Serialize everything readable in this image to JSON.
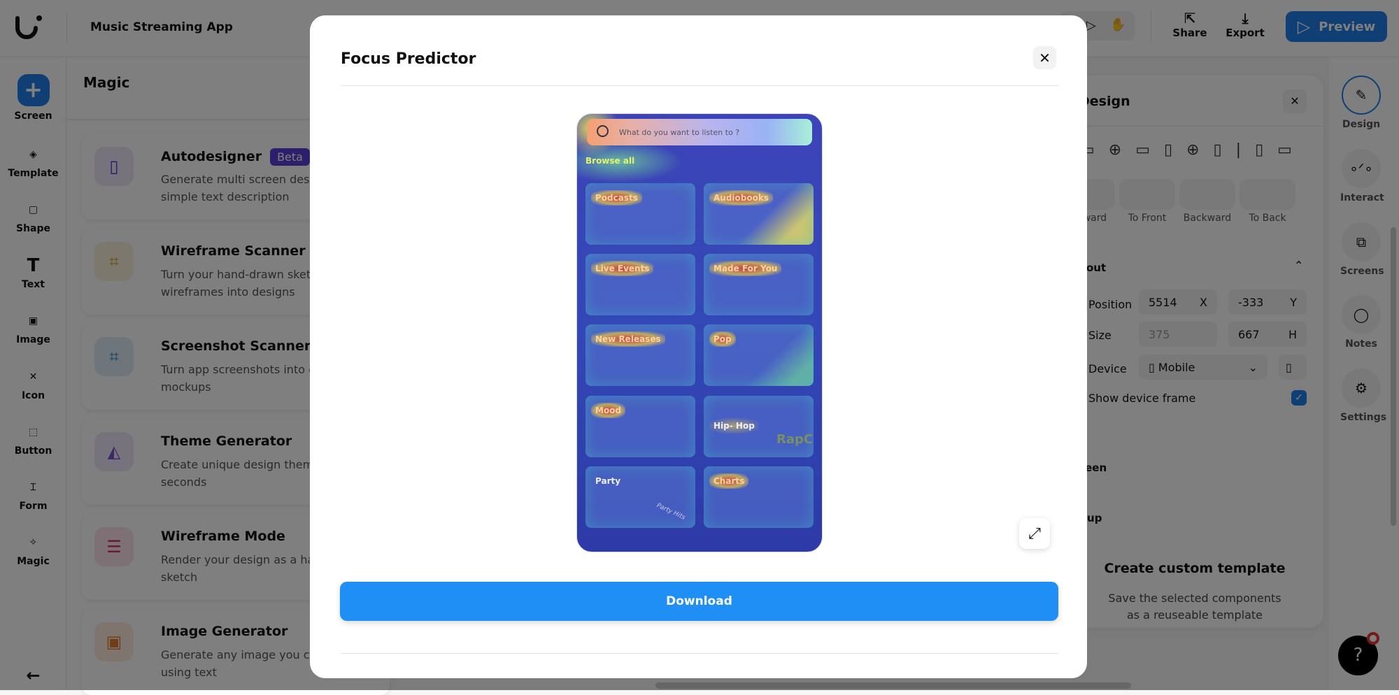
{
  "app": {
    "title": "Music Streaming App"
  },
  "toolbar": {
    "share": "Share",
    "export": "Export",
    "preview": "Preview"
  },
  "rail": [
    {
      "label": "Screen",
      "icon": "plus-icon"
    },
    {
      "label": "Template",
      "icon": "layers-icon"
    },
    {
      "label": "Shape",
      "icon": "shape-icon"
    },
    {
      "label": "Text",
      "icon": "text-icon"
    },
    {
      "label": "Image",
      "icon": "image-icon"
    },
    {
      "label": "Icon",
      "icon": "icon-icon"
    },
    {
      "label": "Button",
      "icon": "button-icon"
    },
    {
      "label": "Form",
      "icon": "form-icon"
    },
    {
      "label": "Magic",
      "icon": "magic-wand-icon"
    }
  ],
  "magic": {
    "title": "Magic",
    "items": [
      {
        "title": "Autodesigner",
        "badge": "Beta",
        "desc": "Generate multi screen design a simple text description",
        "color": "#efe6fb"
      },
      {
        "title": "Wireframe Scanner",
        "desc": "Turn your hand-drawn sketc wireframes into designs",
        "color": "#fbf1dd"
      },
      {
        "title": "Screenshot Scanner",
        "desc": "Turn app screenshots into ec design mockups",
        "color": "#dcedf8"
      },
      {
        "title": "Theme Generator",
        "desc": "Create unique design themes seconds",
        "color": "#efe6fb"
      },
      {
        "title": "Wireframe Mode",
        "desc": "Render your design as a han drawn sketch",
        "color": "#fbe3ea"
      },
      {
        "title": "Image Generator",
        "desc": "Generate any image you car imagine using text",
        "color": "#fcebdc"
      }
    ]
  },
  "design": {
    "title": "Design",
    "arrange": [
      "Forward",
      "To Front",
      "Backward",
      "To Back"
    ],
    "layout": "Layout",
    "position_label": "Position",
    "x": "5514",
    "x_unit": "X",
    "y": "-333",
    "y_unit": "Y",
    "size_label": "Size",
    "w": "375",
    "h": "667",
    "h_unit": "H",
    "device_label": "Device",
    "device": "Mobile",
    "show_frame": "Show device frame",
    "show_frame_checked": true,
    "screen": "Screen",
    "group": "Group",
    "template_title": "Create custom template",
    "template_desc": "Save the selected components as a reuseable template"
  },
  "right_rail": [
    "Design",
    "Interact",
    "Screens",
    "Notes",
    "Settings"
  ],
  "modal": {
    "title": "Focus Predictor",
    "download": "Download",
    "heatmap": {
      "search": "What do you want to listen to ?",
      "browse": "Browse all",
      "cards": [
        "Podcasts",
        "Audiobooks",
        "Live Events",
        "Made For You",
        "New Releases",
        "Pop",
        "Mood",
        "Hip- Hop",
        "Party",
        "Charts"
      ],
      "extra": [
        "RapC",
        "Party Hits"
      ]
    }
  },
  "help": "?",
  "colors": {
    "accent": "#1f7ee8",
    "download": "#1f8ff5",
    "beta": "#5a3fd6"
  }
}
